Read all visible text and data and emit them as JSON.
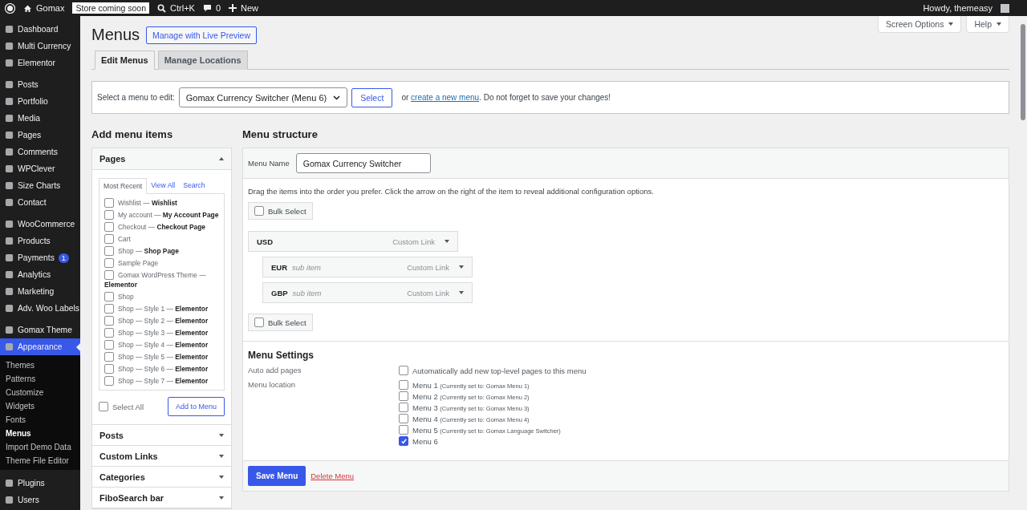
{
  "admin_bar": {
    "site_name": "Gomax",
    "store_badge": "Store coming soon",
    "search_shortcut": "Ctrl+K",
    "comments_count": "0",
    "new_label": "New",
    "greeting": "Howdy, themeasy"
  },
  "sidebar": {
    "groups": [
      {
        "items": [
          {
            "label": "Dashboard",
            "selected": false
          },
          {
            "label": "Multi Currency",
            "selected": false
          },
          {
            "label": "Elementor",
            "selected": false
          }
        ]
      },
      {
        "items": [
          {
            "label": "Posts",
            "selected": false
          },
          {
            "label": "Portfolio",
            "selected": false
          },
          {
            "label": "Media",
            "selected": false
          },
          {
            "label": "Pages",
            "selected": false
          },
          {
            "label": "Comments",
            "selected": false
          },
          {
            "label": "WPClever",
            "selected": false
          },
          {
            "label": "Size Charts",
            "selected": false
          },
          {
            "label": "Contact",
            "selected": false
          }
        ]
      },
      {
        "items": [
          {
            "label": "WooCommerce",
            "selected": false
          },
          {
            "label": "Products",
            "selected": false
          },
          {
            "label": "Payments",
            "selected": false,
            "badge": "1"
          },
          {
            "label": "Analytics",
            "selected": false
          },
          {
            "label": "Marketing",
            "selected": false
          },
          {
            "label": "Adv. Woo Labels",
            "selected": false
          }
        ]
      },
      {
        "items": [
          {
            "label": "Gomax Theme",
            "selected": false
          },
          {
            "label": "Appearance",
            "selected": true,
            "submenu": [
              {
                "label": "Themes",
                "selected": false
              },
              {
                "label": "Patterns",
                "selected": false
              },
              {
                "label": "Customize",
                "selected": false
              },
              {
                "label": "Widgets",
                "selected": false
              },
              {
                "label": "Fonts",
                "selected": false
              },
              {
                "label": "Menus",
                "selected": true
              },
              {
                "label": "Import Demo Data",
                "selected": false
              },
              {
                "label": "Theme File Editor",
                "selected": false
              }
            ]
          }
        ]
      },
      {
        "items": [
          {
            "label": "Plugins",
            "selected": false
          },
          {
            "label": "Users",
            "selected": false
          }
        ]
      }
    ]
  },
  "header": {
    "title": "Menus",
    "live_preview_button": "Manage with Live Preview",
    "screen_options": "Screen Options",
    "help": "Help"
  },
  "tabs": [
    {
      "label": "Edit Menus",
      "selected": true
    },
    {
      "label": "Manage Locations",
      "selected": false
    }
  ],
  "menu_select": {
    "label": "Select a menu to edit:",
    "value": "Gomax Currency Switcher (Menu 6)",
    "button": "Select",
    "text_before": "or",
    "link": "create a new menu",
    "text_after": ". Do not forget to save your changes!"
  },
  "add_items": {
    "title": "Add menu items",
    "panels": [
      {
        "title": "Pages",
        "expanded": true,
        "tabs": [
          {
            "label": "Most Recent",
            "selected": true
          },
          {
            "label": "View All",
            "selected": false
          },
          {
            "label": "Search",
            "selected": false
          }
        ],
        "items": [
          {
            "label": "Wishlist — **Wishlist**",
            "checked": false
          },
          {
            "label": "My account — **My Account Page**",
            "checked": false
          },
          {
            "label": "Checkout — **Checkout Page**",
            "checked": false
          },
          {
            "label": "Cart",
            "checked": false
          },
          {
            "label": "Shop — **Shop Page**",
            "checked": false
          },
          {
            "label": "Sample Page",
            "checked": false
          },
          {
            "label": "Gomax WordPress Theme — **Elementor**",
            "checked": false
          },
          {
            "label": "Shop",
            "checked": false
          },
          {
            "label": "Shop — Style 1 — **Elementor**",
            "checked": false
          },
          {
            "label": "Shop — Style 2 — **Elementor**",
            "checked": false
          },
          {
            "label": "Shop — Style 3 — **Elementor**",
            "checked": false
          },
          {
            "label": "Shop — Style 4 — **Elementor**",
            "checked": false
          },
          {
            "label": "Shop — Style 5 — **Elementor**",
            "checked": false
          },
          {
            "label": "Shop — Style 6 — **Elementor**",
            "checked": false
          },
          {
            "label": "Shop — Style 7 — **Elementor**",
            "checked": false
          }
        ],
        "select_all": {
          "label": "Select All",
          "checked": false
        },
        "add_button": "Add to Menu"
      },
      {
        "title": "Posts",
        "expanded": false
      },
      {
        "title": "Custom Links",
        "expanded": false
      },
      {
        "title": "Categories",
        "expanded": false
      },
      {
        "title": "FiboSearch bar",
        "expanded": false
      }
    ]
  },
  "menu_structure": {
    "title": "Menu structure",
    "name_label": "Menu Name",
    "name_value": "Gomax Currency Switcher",
    "instructions": "Drag the items into the order you prefer. Click the arrow on the right of the item to reveal additional configuration options.",
    "bulk_select_top": {
      "label": "Bulk Select",
      "checked": false
    },
    "items": [
      {
        "title": "USD",
        "type": "Custom Link",
        "children": [
          {
            "title": "EUR",
            "note": "sub item",
            "type": "Custom Link"
          },
          {
            "title": "GBP",
            "note": "sub item",
            "type": "Custom Link"
          }
        ]
      }
    ],
    "bulk_select_bottom": {
      "label": "Bulk Select",
      "checked": false
    },
    "settings": {
      "title": "Menu Settings",
      "auto_add_label": "Auto add pages",
      "auto_add_option": {
        "label": "Automatically add new top-level pages to this menu",
        "checked": false
      },
      "location_label": "Menu location",
      "locations": [
        {
          "label": "Menu 1",
          "note": "(Currently set to: Gomax Menu 1)",
          "checked": false
        },
        {
          "label": "Menu 2",
          "note": "(Currently set to: Gomax Menu 2)",
          "checked": false
        },
        {
          "label": "Menu 3",
          "note": "(Currently set to: Gomax Menu 3)",
          "checked": false
        },
        {
          "label": "Menu 4",
          "note": "(Currently set to: Gomax Menu 4)",
          "checked": false
        },
        {
          "label": "Menu 5",
          "note": "(Currently set to: Gomax Language Switcher)",
          "checked": false
        },
        {
          "label": "Menu 6",
          "checked": true
        }
      ]
    },
    "save_button": "Save Menu",
    "delete_link": "Delete Menu"
  }
}
